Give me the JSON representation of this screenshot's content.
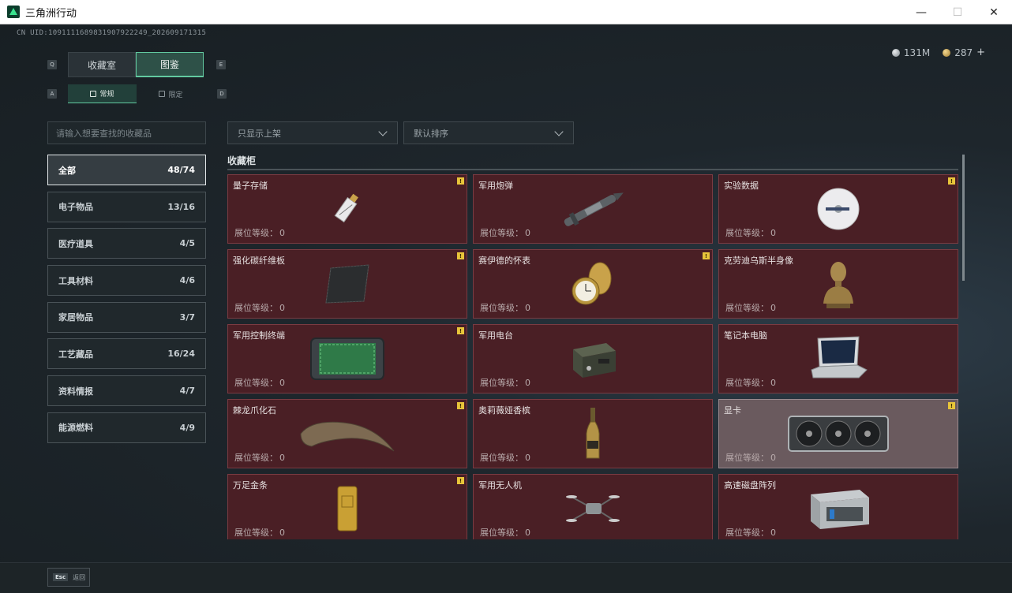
{
  "window": {
    "title": "三角洲行动",
    "minimize": "—",
    "maximize": "☐",
    "close": "✕"
  },
  "uid": "CN UID:1091111689831907922⁠249_202609171315",
  "currency": {
    "silver": "131M",
    "gold": "287",
    "plus": "+"
  },
  "keys": {
    "q": "Q",
    "e": "E",
    "a": "A",
    "d": "D"
  },
  "tabs": [
    {
      "label": "收藏室"
    },
    {
      "label": "图鉴"
    }
  ],
  "subtabs": [
    {
      "label": "常规"
    },
    {
      "label": "限定"
    }
  ],
  "search": {
    "placeholder": "请输入想要查找的收藏品"
  },
  "filters": {
    "shelf": "只显示上架",
    "sort": "默认排序"
  },
  "categories": [
    {
      "label": "全部",
      "count": "48/74"
    },
    {
      "label": "电子物品",
      "count": "13/16"
    },
    {
      "label": "医疗道具",
      "count": "4/5"
    },
    {
      "label": "工具材料",
      "count": "4/6"
    },
    {
      "label": "家居物品",
      "count": "3/7"
    },
    {
      "label": "工艺藏品",
      "count": "16/24"
    },
    {
      "label": "资料情报",
      "count": "4/7"
    },
    {
      "label": "能源燃料",
      "count": "4/9"
    }
  ],
  "section": {
    "title": "收藏柜"
  },
  "level_label": "展位等级：",
  "badge_text": "!",
  "items": [
    {
      "name": "量子存储",
      "level": "0",
      "icon": "usb-drive-icon"
    },
    {
      "name": "军用炮弹",
      "level": "0",
      "icon": "missile-icon"
    },
    {
      "name": "实验数据",
      "level": "0",
      "icon": "disc-icon"
    },
    {
      "name": "强化碳纤维板",
      "level": "0",
      "icon": "carbon-plate-icon"
    },
    {
      "name": "赛伊德的怀表",
      "level": "0",
      "icon": "pocket-watch-icon"
    },
    {
      "name": "克劳迪乌斯半身像",
      "level": "0",
      "icon": "bust-icon"
    },
    {
      "name": "军用控制终端",
      "level": "0",
      "icon": "control-terminal-icon"
    },
    {
      "name": "军用电台",
      "level": "0",
      "icon": "radio-icon"
    },
    {
      "name": "笔记本电脑",
      "level": "0",
      "icon": "laptop-icon"
    },
    {
      "name": "棘龙爪化石",
      "level": "0",
      "icon": "claw-fossil-icon"
    },
    {
      "name": "奥莉薇娅香槟",
      "level": "0",
      "icon": "champagne-icon"
    },
    {
      "name": "显卡",
      "level": "0",
      "icon": "graphics-card-icon"
    },
    {
      "name": "万足金条",
      "level": "0",
      "icon": "gold-bar-icon"
    },
    {
      "name": "军用无人机",
      "level": "0",
      "icon": "drone-icon"
    },
    {
      "name": "高速磁盘阵列",
      "level": "0",
      "icon": "disk-array-icon"
    }
  ],
  "bottom": {
    "esc_key": "Esc",
    "esc_label": "返回"
  }
}
